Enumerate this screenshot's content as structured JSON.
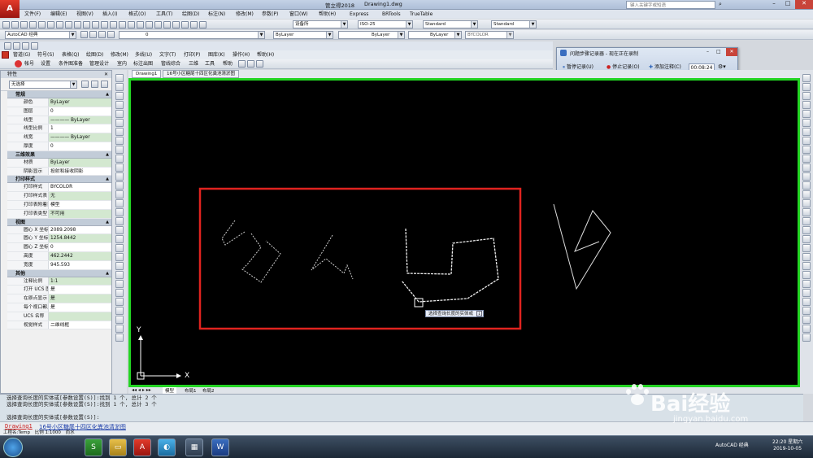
{
  "window": {
    "app_title": "管立得2018",
    "doc_title": "Drawing1.dwg",
    "search_placeholder": "键入关键字或短语"
  },
  "menubar": [
    "文件(F)",
    "编辑(E)",
    "视图(V)",
    "插入(I)",
    "格式(O)",
    "工具(T)",
    "绘图(D)",
    "标注(N)",
    "修改(M)",
    "参数(P)",
    "窗口(W)",
    "帮助(H)",
    "Express",
    "BRTools",
    "TrueTable"
  ],
  "toolbar1": {
    "layer_combo": "设备所",
    "dimstyle_combo": "ISO-25",
    "textstyle_combo": "Standard",
    "tablestyle_combo": "Standard"
  },
  "toolbar2": {
    "workspace": "AutoCAD 经典",
    "layer_value": "0",
    "color": "ByLayer",
    "linetype": "ByLayer",
    "lineweight": "ByLayer",
    "plotstyle": "BYCOLOR"
  },
  "menubar2": [
    "管道(G)",
    "符号(S)",
    "表格(Q)",
    "绘图(D)",
    "修改(M)",
    "多线(U)",
    "文字(T)",
    "打印(P)",
    "图库(K)",
    "操作(H)",
    "帮助(H)"
  ],
  "menubar3": [
    "帐号",
    "设置",
    "条件图准备",
    "管理设计",
    "室内",
    "标注出图",
    "管线综合",
    "三维",
    "工具",
    "帮助"
  ],
  "doc_tabs": [
    "Drawing1",
    "16号小区糖尾十四区化粪池清淤图"
  ],
  "properties": {
    "title": "特性",
    "selection": "无选择",
    "sections": [
      {
        "name": "常规",
        "rows": [
          {
            "k": "颜色",
            "v": "ByLayer",
            "g": true
          },
          {
            "k": "图层",
            "v": "0"
          },
          {
            "k": "线型",
            "v": "———— ByLayer",
            "g": true
          },
          {
            "k": "线型比例",
            "v": "1"
          },
          {
            "k": "线宽",
            "v": "———— ByLayer",
            "g": true
          },
          {
            "k": "厚度",
            "v": "0"
          }
        ]
      },
      {
        "name": "三维效果",
        "rows": [
          {
            "k": "材质",
            "v": "ByLayer",
            "g": true
          },
          {
            "k": "阴影显示",
            "v": "投射和接收阴影"
          }
        ]
      },
      {
        "name": "打印样式",
        "rows": [
          {
            "k": "打印样式",
            "v": "BYCOLOR"
          },
          {
            "k": "打印样式表",
            "v": "无",
            "g": true
          },
          {
            "k": "打印表附着到",
            "v": "模型"
          },
          {
            "k": "打印表类型",
            "v": "不可用",
            "g": true
          }
        ]
      },
      {
        "name": "视图",
        "rows": [
          {
            "k": "圆心 X 坐标",
            "v": "2089.2098"
          },
          {
            "k": "圆心 Y 坐标",
            "v": "1254.8442",
            "g": true
          },
          {
            "k": "圆心 Z 坐标",
            "v": "0"
          },
          {
            "k": "高度",
            "v": "462.2442",
            "g": true
          },
          {
            "k": "宽度",
            "v": "945.593"
          }
        ]
      },
      {
        "name": "其他",
        "rows": [
          {
            "k": "注释比例",
            "v": "1:1",
            "g": true
          },
          {
            "k": "打开 UCS 图标",
            "v": "是"
          },
          {
            "k": "在原点显示 UC...",
            "v": "是",
            "g": true
          },
          {
            "k": "每个视口都显示...",
            "v": "是"
          },
          {
            "k": "UCS 名称",
            "v": "",
            "g": true
          },
          {
            "k": "视觉样式",
            "v": "二维线框"
          }
        ]
      }
    ]
  },
  "canvas": {
    "tooltip": "选择查询长度的实体或",
    "axis_x": "X",
    "axis_y": "Y",
    "layout_tabs": [
      "模型",
      "布局1",
      "布局2"
    ]
  },
  "command": {
    "lines": [
      "选择查询长度的实体或[参数设置(S)]:找到 1 个, 总计 2 个",
      "选择查询长度的实体或[参数设置(S)]:找到 1 个, 总计 3 个",
      "",
      "选择查询长度的实体或[参数设置(S)]:"
    ],
    "doc_link": "Drawing1",
    "doc_link2": "16号小区糖尾十四区化粪池清淤图"
  },
  "recorder": {
    "title": "问题步骤记录器 - 现在正在录制",
    "pause": "暂停记录(U)",
    "stop": "停止记录(O)",
    "comment": "添加注释(C)",
    "timer": "00:08:24"
  },
  "statusbar": {
    "project": "工程名:Temp",
    "scale": "比例 1:1000",
    "unit": "而水"
  },
  "taskbar": {
    "apps": [
      "S",
      "▭",
      "A",
      "◐",
      "▦",
      "W"
    ],
    "ime": "AutoCAD 经典",
    "time": "22:20 星期六",
    "date": "2019-10-05"
  },
  "watermark": {
    "brand": "Bai经验",
    "url": "jingyan.baidu.com"
  },
  "colors": {
    "canvas_bg": "#000000",
    "canvas_border": "#23d423",
    "highlight_rect": "#e0231f",
    "props_green": "#d3e8d0"
  }
}
